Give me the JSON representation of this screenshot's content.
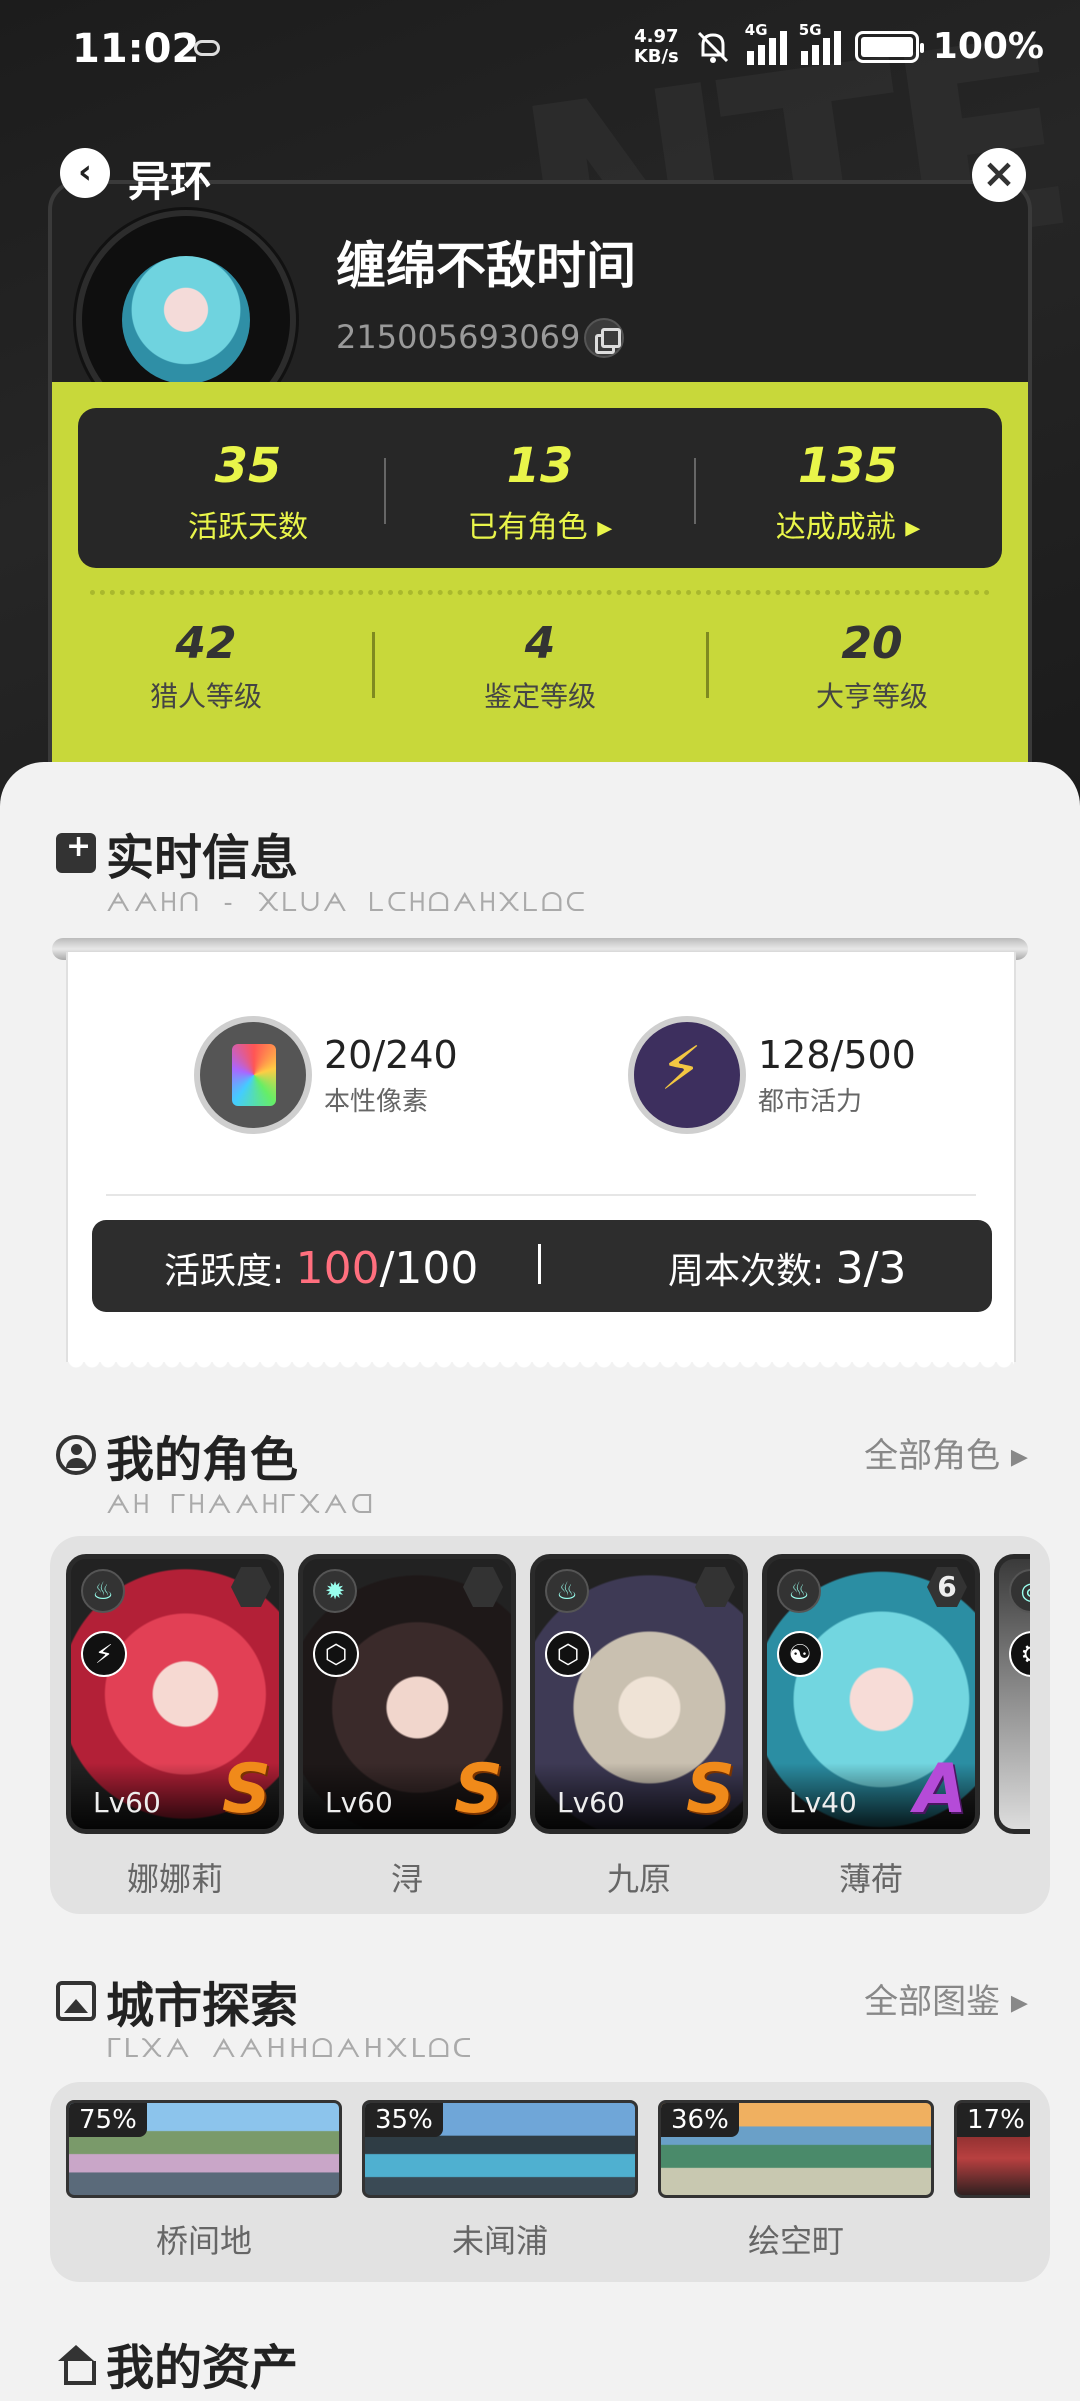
{
  "status_bar": {
    "time": "11:02",
    "speed_value": "4.97",
    "speed_unit": "KB/s",
    "net1": "4G",
    "net2": "5G",
    "battery": "100%"
  },
  "header": {
    "title": "异环",
    "back_icon": "back-arrow-icon",
    "close_icon": "close-icon"
  },
  "profile": {
    "name": "缠绵不敌时间",
    "uid": "215005693069",
    "stats": [
      {
        "value": "35",
        "label": "活跃天数"
      },
      {
        "value": "13",
        "label": "已有角色 ▸"
      },
      {
        "value": "135",
        "label": "达成成就 ▸"
      }
    ],
    "levels": [
      {
        "value": "42",
        "label": "猎人等级"
      },
      {
        "value": "4",
        "label": "鉴定等级"
      },
      {
        "value": "20",
        "label": "大亨等级"
      }
    ],
    "accent_color": "#c8d83a"
  },
  "realtime": {
    "title": "实时信息",
    "subtitle": "ᗅᗅᕼᑎ - ᙭ᒪᑌᗅ ᒪᑕᕼᗝᗅᕼ᙭ᒪᗝᑕ",
    "resources": [
      {
        "value": "20/240",
        "label": "本性像素",
        "icon": "card-icon"
      },
      {
        "value": "128/500",
        "label": "都市活力",
        "icon": "bolt-icon"
      }
    ],
    "activity_label": "活跃度: ",
    "activity_current": "100",
    "activity_total": "/100",
    "weekly_label": "周本次数: ",
    "weekly_value": "3/3"
  },
  "characters": {
    "title": "我的角色",
    "subtitle": "ᗅᕼ ᒥᕼᗅᗅᕼᒥ᙭ᗅᗡ",
    "link": "全部角色 ▸",
    "items": [
      {
        "name": "娜娜莉",
        "level": "Lv60",
        "rank": "S",
        "elem": "♨",
        "type": "⚡",
        "gear": ""
      },
      {
        "name": "浔",
        "level": "Lv60",
        "rank": "S",
        "elem": "✹",
        "type": "⬡",
        "gear": ""
      },
      {
        "name": "九原",
        "level": "Lv60",
        "rank": "S",
        "elem": "♨",
        "type": "⬡",
        "gear": ""
      },
      {
        "name": "薄荷",
        "level": "Lv40",
        "rank": "A",
        "elem": "♨",
        "type": "☯",
        "gear": "6"
      },
      {
        "name": "",
        "level": "",
        "rank": "",
        "elem": "◎",
        "type": "⚙",
        "gear": ""
      }
    ]
  },
  "city": {
    "title": "城市探索",
    "subtitle": "ᒥᒪ᙭ᗅ ᗅᗅᕼᕼᗝᗅᕼ᙭ᒪᗝᑕ",
    "link": "全部图鉴 ▸",
    "items": [
      {
        "name": "桥间地",
        "percent": "75%"
      },
      {
        "name": "未闻浦",
        "percent": "35%"
      },
      {
        "name": "绘空町",
        "percent": "36%"
      },
      {
        "name": "",
        "percent": "17%"
      }
    ]
  },
  "assets": {
    "title": "我的资产"
  }
}
